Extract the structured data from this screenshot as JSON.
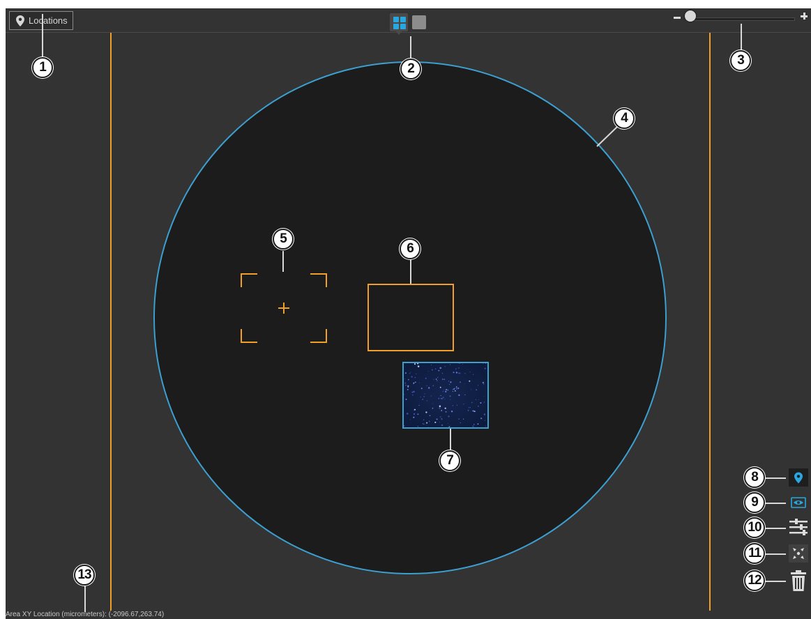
{
  "header": {
    "locations_label": "Locations",
    "locations_icon": "map-pin-icon",
    "view_modes": [
      {
        "name": "grid-view",
        "icon": "grid-icon",
        "active": true
      },
      {
        "name": "single-view",
        "icon": "square-icon",
        "active": false
      }
    ],
    "zoom": {
      "level": 0.05,
      "minus_icon": "minus-icon",
      "plus_icon": "plus-icon"
    }
  },
  "colors": {
    "accent_blue": "#29a8e0",
    "stage_orange": "#f0a028",
    "well_outline": "#3d9fd0",
    "background": "#333333",
    "well_fill": "#1c1c1c"
  },
  "canvas": {
    "well": "circular-well",
    "target": "crosshair-target",
    "area": "orange-area-box",
    "capture": "captured-image-thumbnail"
  },
  "toolbar": [
    {
      "name": "location-pin-tool",
      "icon": "map-pin-icon"
    },
    {
      "name": "preview-tool",
      "icon": "eye-icon"
    },
    {
      "name": "adjust-tool",
      "icon": "sliders-icon"
    },
    {
      "name": "fit-tool",
      "icon": "expand-icon"
    },
    {
      "name": "delete-tool",
      "icon": "trash-icon"
    }
  ],
  "status": {
    "location_text": "Area XY Location (micrometers): (-2096.67,263.74)"
  },
  "callouts": [
    "1",
    "2",
    "3",
    "4",
    "5",
    "6",
    "7",
    "8",
    "9",
    "10",
    "11",
    "12",
    "13"
  ]
}
